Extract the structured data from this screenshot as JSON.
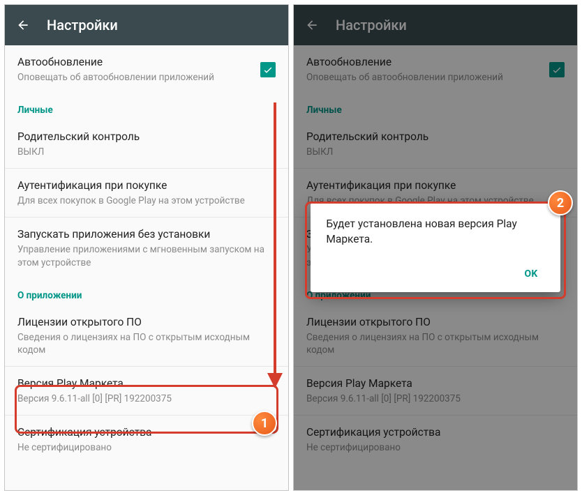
{
  "header": {
    "title": "Настройки"
  },
  "autoupdate": {
    "title": "Автообновление",
    "subtitle": "Оповещать об автообновлении приложений",
    "checked": true
  },
  "sections": {
    "personal": "Личные",
    "about": "О приложении"
  },
  "parental": {
    "title": "Родительский контроль",
    "subtitle": "ВЫКЛ"
  },
  "auth": {
    "title": "Аутентификация при покупке",
    "subtitle": "Для всех покупок в Google Play на этом устройстве"
  },
  "instant": {
    "title": "Запускать приложения без установки",
    "subtitle": "Управление приложениями с мгновенным запуском на этом устройстве"
  },
  "licenses": {
    "title": "Лицензии открытого ПО",
    "subtitle": "Сведения о лицензиях на ПО с открытым исходным кодом"
  },
  "version": {
    "title": "Версия Play Маркета",
    "subtitle": "Версия 9.6.11-all [0] [PR] 192200375"
  },
  "cert": {
    "title": "Сертификация устройства",
    "subtitle": "Не сертифицировано"
  },
  "dialog": {
    "message": "Будет установлена новая версия Play Маркета.",
    "ok": "OK"
  },
  "badges": {
    "one": "1",
    "two": "2"
  }
}
